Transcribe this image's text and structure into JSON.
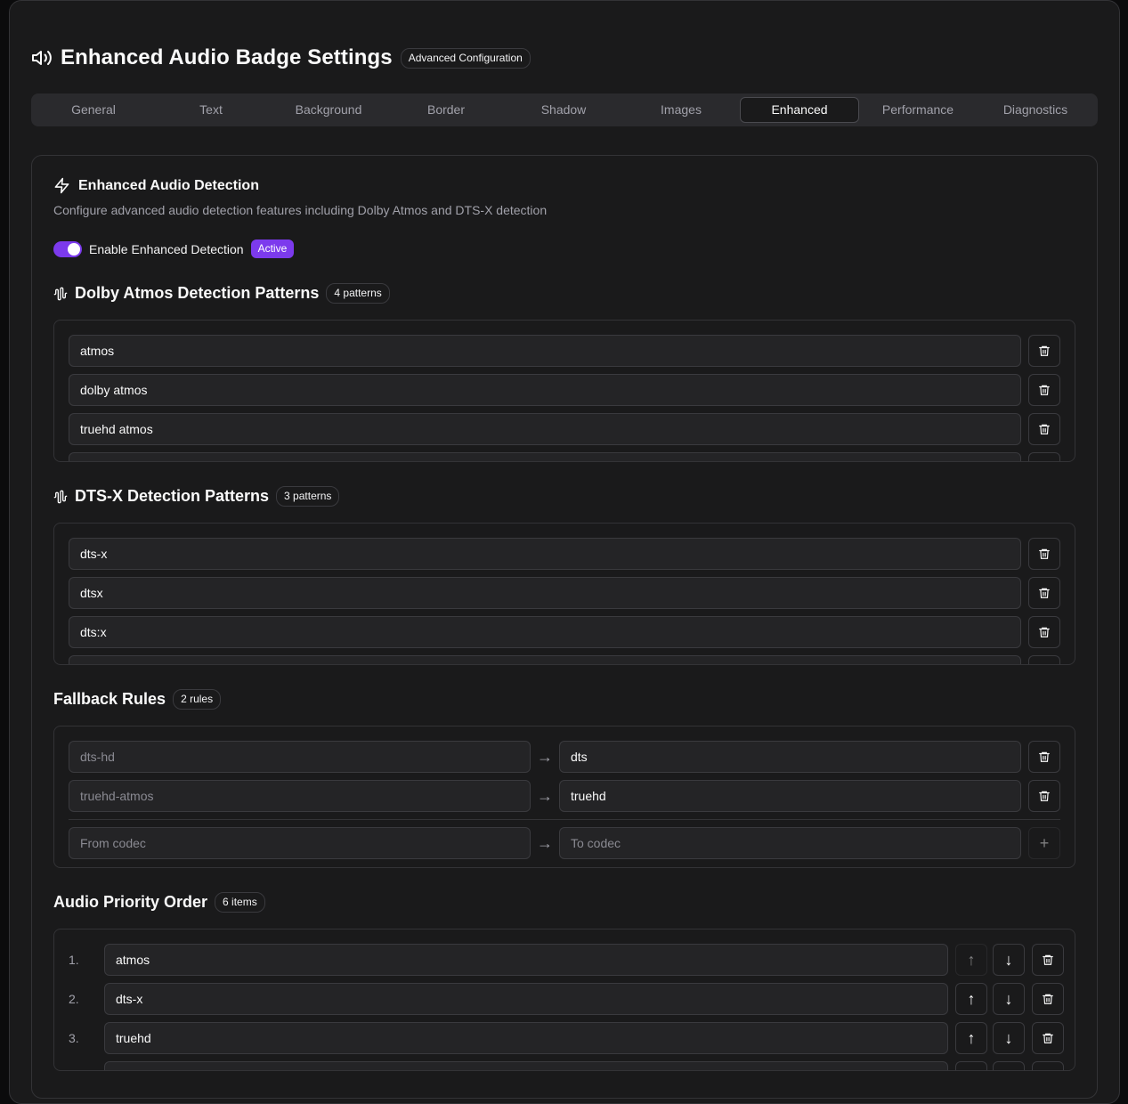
{
  "header": {
    "title": "Enhanced Audio Badge Settings",
    "badge": "Advanced Configuration"
  },
  "tabs": [
    "General",
    "Text",
    "Background",
    "Border",
    "Shadow",
    "Images",
    "Enhanced",
    "Performance",
    "Diagnostics"
  ],
  "active_tab": "Enhanced",
  "card": {
    "title": "Enhanced Audio Detection",
    "description": "Configure advanced audio detection features including Dolby Atmos and DTS-X detection",
    "toggle_label": "Enable Enhanced Detection",
    "toggle_on": true,
    "status_badge": "Active"
  },
  "dolby": {
    "title": "Dolby Atmos Detection Patterns",
    "count_badge": "4 patterns",
    "patterns": [
      "atmos",
      "dolby atmos",
      "truehd atmos"
    ]
  },
  "dtsx": {
    "title": "DTS-X Detection Patterns",
    "count_badge": "3 patterns",
    "patterns": [
      "dts-x",
      "dtsx",
      "dts:x"
    ]
  },
  "fallback": {
    "title": "Fallback Rules",
    "count_badge": "2 rules",
    "rules": [
      {
        "from": "dts-hd",
        "to": "dts"
      },
      {
        "from": "truehd-atmos",
        "to": "truehd"
      }
    ],
    "arrow": "→",
    "from_placeholder": "From codec",
    "to_placeholder": "To codec",
    "add_glyph": "+"
  },
  "priority": {
    "title": "Audio Priority Order",
    "count_badge": "6 items",
    "items": [
      {
        "index": "1.",
        "value": "atmos"
      },
      {
        "index": "2.",
        "value": "dts-x"
      },
      {
        "index": "3.",
        "value": "truehd"
      }
    ],
    "up_glyph": "↑",
    "down_glyph": "↓"
  },
  "icons": {
    "header": "speaker-icon",
    "card": "lightning-icon",
    "section": "waveform-icon",
    "delete": "trash-icon"
  },
  "colors": {
    "accent": "#7c3aed",
    "background": "#1a1a1b",
    "border": "#333336"
  }
}
